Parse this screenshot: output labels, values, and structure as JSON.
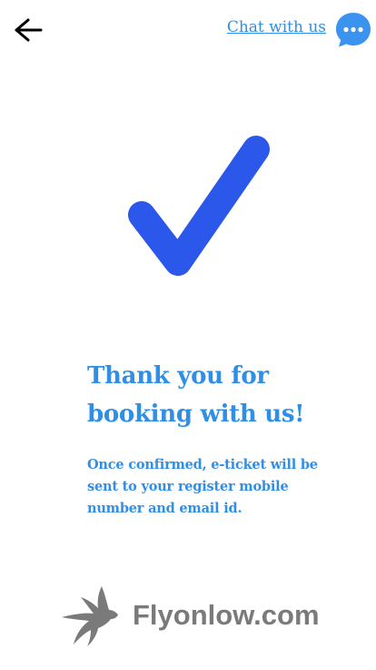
{
  "colors": {
    "accent": "#2f8fe6",
    "check": "#2b58ea",
    "brand_gray": "#7a7a7a",
    "bubble": "#3a93ef"
  },
  "header": {
    "back_icon": "arrow-left-icon",
    "chat_link_label": "Chat with us",
    "chat_icon": "chat-bubble-dots-icon"
  },
  "confirmation": {
    "icon": "check-mark-icon",
    "title_lines": [
      "Thank you for",
      "booking with us!"
    ],
    "message_lines": [
      "Once confirmed, e-ticket will be",
      "sent to your register mobile",
      "number and email id."
    ]
  },
  "footer": {
    "logo_icon": "bird-logo-icon",
    "brand_name": "Flyonlow.com"
  }
}
